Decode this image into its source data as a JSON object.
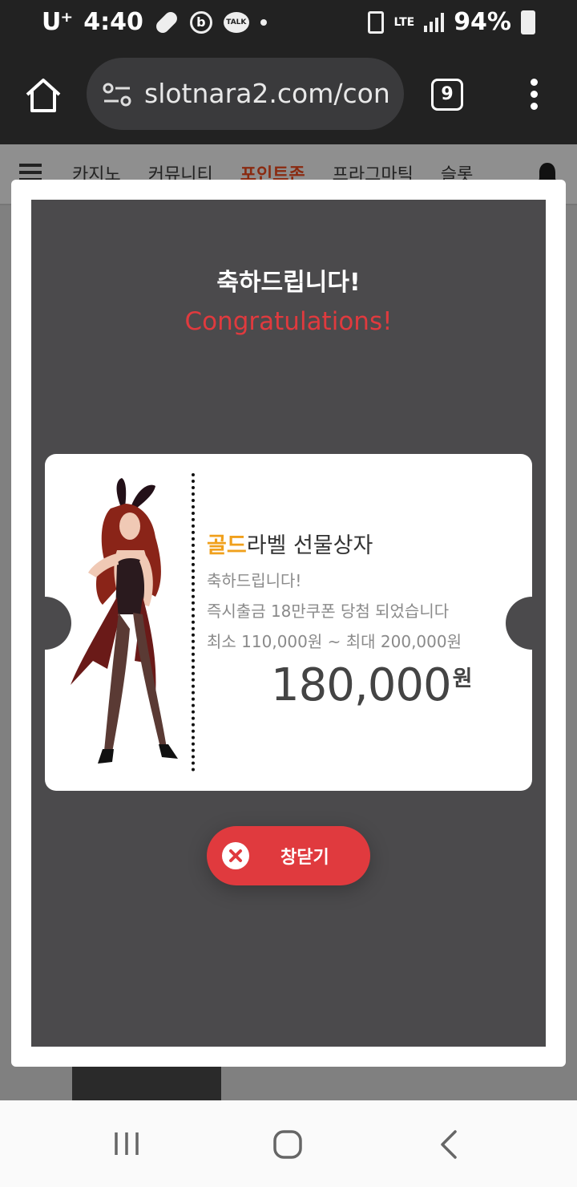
{
  "status_bar": {
    "carrier": "U⁺",
    "time": "4:40",
    "lte": "LTE",
    "battery": "94%"
  },
  "browser": {
    "url": "slotnara2.com/con",
    "tab_count": "9"
  },
  "site_nav": {
    "items": [
      "카지노",
      "커뮤니티",
      "포인트존",
      "프라그마틱",
      "슬롯"
    ]
  },
  "modal": {
    "title_ko": "축하드립니다!",
    "title_en": "Congratulations!",
    "coupon": {
      "title_highlight": "골드",
      "title_rest": "라벨 선물상자",
      "line1": "축하드립니다!",
      "line2": "즉시출금 18만쿠폰 당첨 되었습니다",
      "line3": "최소 110,000원 ~ 최대 200,000원",
      "amount": "180,000",
      "currency": "원"
    },
    "close_label": "창닫기"
  },
  "colors": {
    "accent_red": "#e03a3e",
    "gold": "#f0a01c",
    "modal_bg": "#4b4a4c"
  }
}
